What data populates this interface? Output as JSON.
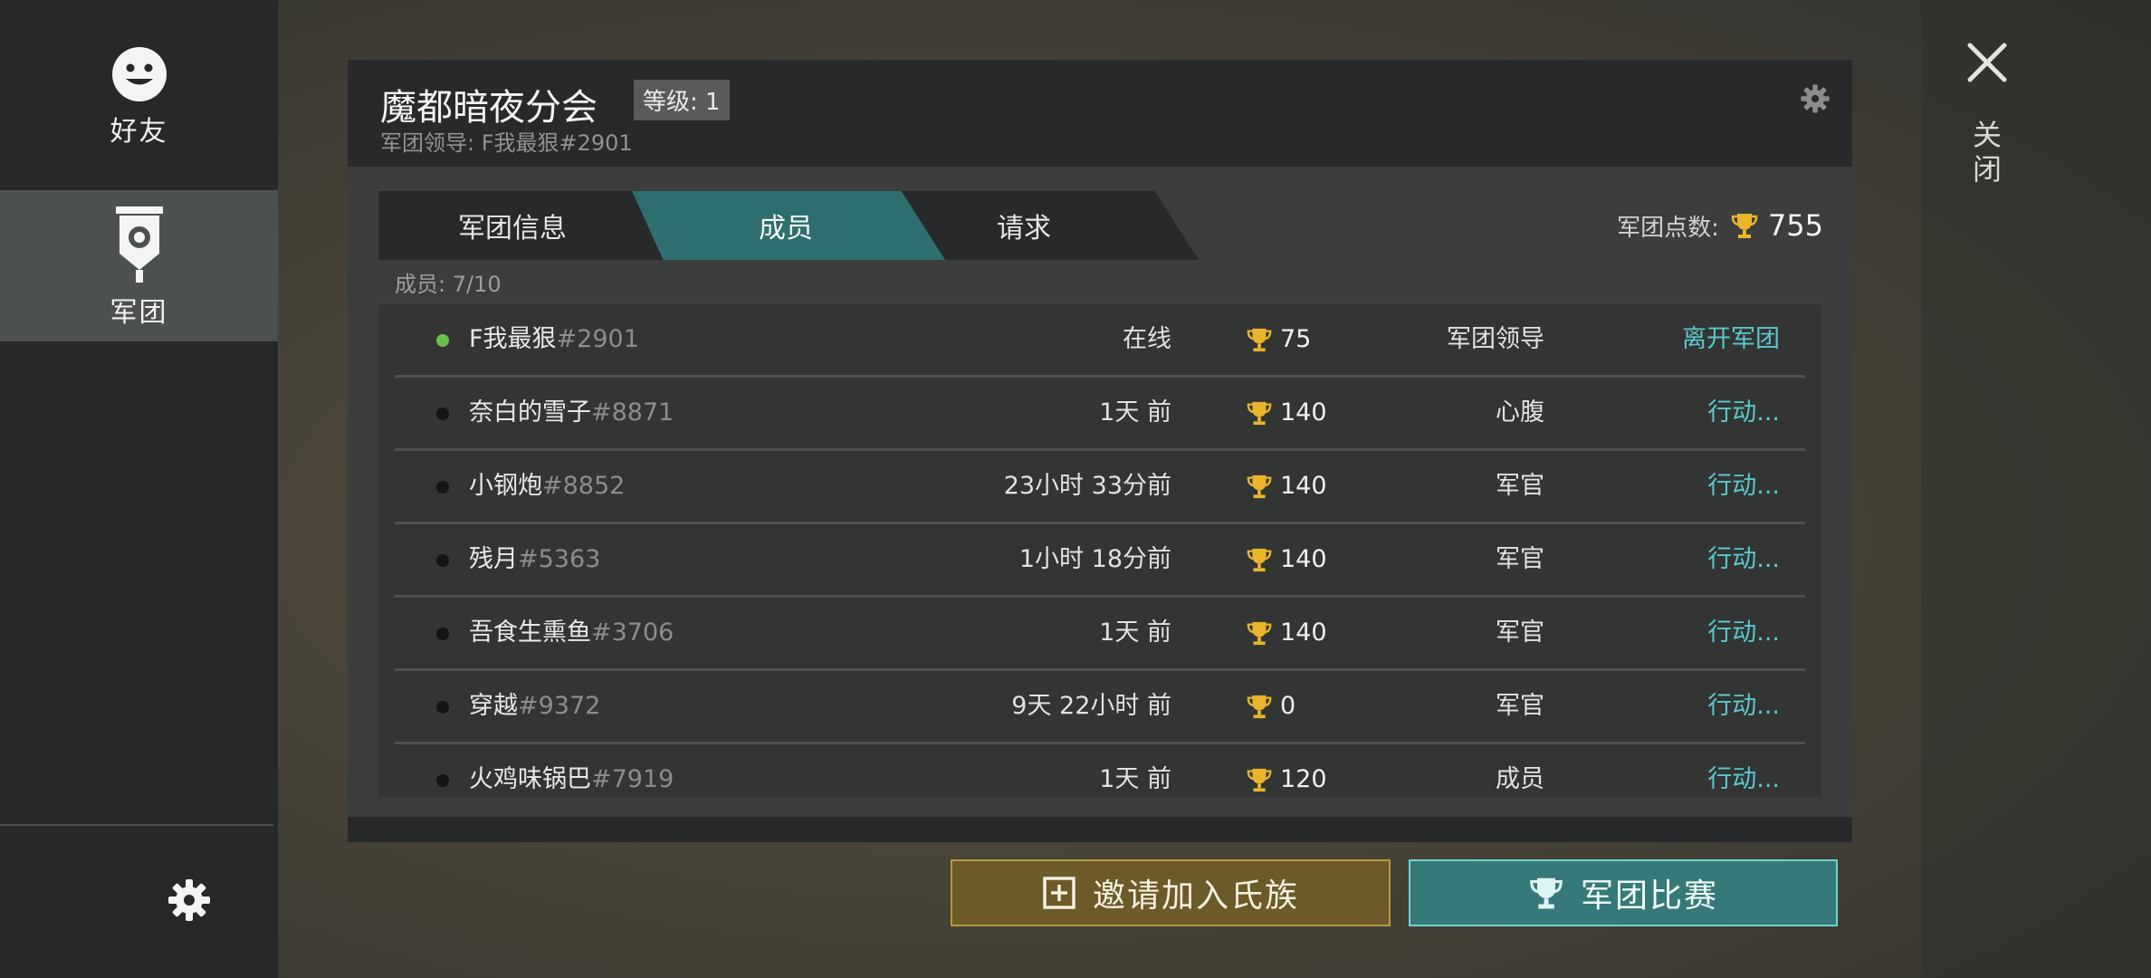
{
  "sidebar": {
    "friends_label": "好友",
    "legion_label": "军团"
  },
  "close": {
    "label": "关闭"
  },
  "panel": {
    "title": "魔都暗夜分会",
    "level": "等级: 1",
    "leader_line": "军团领导: F我最狠#2901"
  },
  "tabs": {
    "info": "军团信息",
    "members": "成员",
    "requests": "请求"
  },
  "points": {
    "label": "军团点数:",
    "value": "755"
  },
  "list": {
    "count_label": "成员: 7/10",
    "members": [
      {
        "name": "F我最狠",
        "tag": "#2901",
        "online": true,
        "time": "在线",
        "trophies": "75",
        "role": "军团领导",
        "action": "离开军团"
      },
      {
        "name": "奈白的雪子",
        "tag": "#8871",
        "online": false,
        "time": "1天 前",
        "trophies": "140",
        "role": "心腹",
        "action": "行动..."
      },
      {
        "name": "小钢炮",
        "tag": "#8852",
        "online": false,
        "time": "23小时 33分前",
        "trophies": "140",
        "role": "军官",
        "action": "行动..."
      },
      {
        "name": "残月",
        "tag": "#5363",
        "online": false,
        "time": "1小时 18分前",
        "trophies": "140",
        "role": "军官",
        "action": "行动..."
      },
      {
        "name": "吾食生熏鱼",
        "tag": "#3706",
        "online": false,
        "time": "1天 前",
        "trophies": "140",
        "role": "军官",
        "action": "行动..."
      },
      {
        "name": "穿越",
        "tag": "#9372",
        "online": false,
        "time": "9天 22小时 前",
        "trophies": "0",
        "role": "军官",
        "action": "行动..."
      },
      {
        "name": "火鸡味锅巴",
        "tag": "#7919",
        "online": false,
        "time": "1天 前",
        "trophies": "120",
        "role": "成员",
        "action": "行动..."
      }
    ]
  },
  "buttons": {
    "invite": "邀请加入氏族",
    "contest": "军团比赛"
  },
  "colors": {
    "accent_teal": "#2f6e6f",
    "action_link": "#5cc8cf",
    "online_dot": "#6dc04a",
    "trophy_gold": "#e8b52c",
    "invite_button": "#6d5a29"
  },
  "icons": {
    "friends": "smiley-face-icon",
    "legion": "banner-shield-icon",
    "settings": "gear-icon",
    "close": "close-x-icon",
    "trophy": "trophy-icon",
    "invite": "plus-box-icon"
  }
}
